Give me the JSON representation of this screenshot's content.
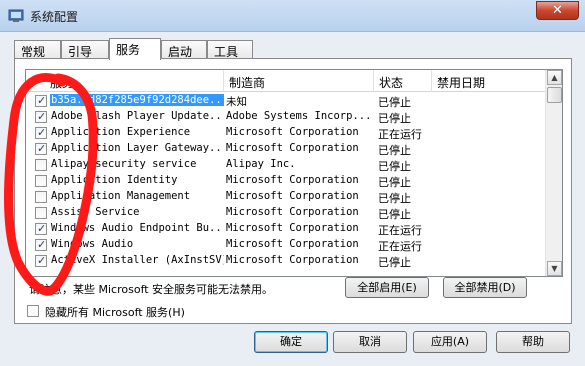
{
  "window": {
    "title": "系统配置",
    "close_label": "✕"
  },
  "tabs": [
    {
      "label": "常规"
    },
    {
      "label": "引导"
    },
    {
      "label": "服务",
      "active": true
    },
    {
      "label": "启动"
    },
    {
      "label": "工具"
    }
  ],
  "columns": {
    "service": "服务",
    "manufacturer": "制造商",
    "status": "状态",
    "disabled_date": "禁用日期"
  },
  "services": [
    {
      "name": "b35a..d82f285e9f92d284dee...",
      "manufacturer": "未知",
      "status": "已停止",
      "checked": true,
      "selected": true
    },
    {
      "name": "Adobe Flash Player Update...",
      "manufacturer": "Adobe Systems Incorp...",
      "status": "已停止",
      "checked": true
    },
    {
      "name": "Application Experience",
      "manufacturer": "Microsoft Corporation",
      "status": "正在运行",
      "checked": true
    },
    {
      "name": "Application Layer Gateway...",
      "manufacturer": "Microsoft Corporation",
      "status": "已停止",
      "checked": true
    },
    {
      "name": "Alipay security service",
      "manufacturer": "Alipay Inc.",
      "status": "已停止",
      "checked": false
    },
    {
      "name": "Application Identity",
      "manufacturer": "Microsoft Corporation",
      "status": "已停止",
      "checked": false
    },
    {
      "name": "Application Management",
      "manufacturer": "Microsoft Corporation",
      "status": "已停止",
      "checked": false
    },
    {
      "name": "Assist Service",
      "manufacturer": "Microsoft Corporation",
      "status": "已停止",
      "checked": false
    },
    {
      "name": "Windows Audio Endpoint Bu...",
      "manufacturer": "Microsoft Corporation",
      "status": "正在运行",
      "checked": true
    },
    {
      "name": "Windows Audio",
      "manufacturer": "Microsoft Corporation",
      "status": "正在运行",
      "checked": true
    },
    {
      "name": "ActiveX Installer (AxInstSV)",
      "manufacturer": "Microsoft Corporation",
      "status": "已停止",
      "checked": true
    }
  ],
  "note": "请注意，某些 Microsoft 安全服务可能无法禁用。",
  "enable_all": "全部启用(E)",
  "disable_all": "全部禁用(D)",
  "hide_ms": "隐藏所有 Microsoft 服务(H)",
  "buttons": {
    "ok": "确定",
    "cancel": "取消",
    "apply": "应用(A)",
    "help": "帮助"
  },
  "colors": {
    "selection": "#3399ff",
    "annotation": "#ff1a1a"
  }
}
